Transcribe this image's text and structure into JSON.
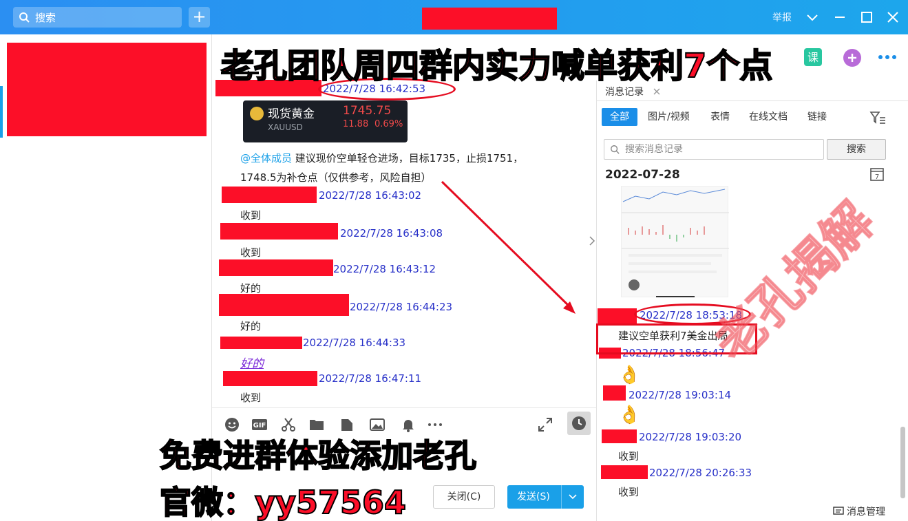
{
  "titlebar": {
    "search_placeholder": "搜索",
    "add_label": "+",
    "report": "举报"
  },
  "overlay": {
    "top_banner": "老孔团队周四群内实力喊单获利7个点",
    "line1": "免费进群体验添加老孔",
    "line2": "官微：yy57564",
    "watermark": "老孔揭解"
  },
  "gold_card": {
    "name": "现货黄金",
    "code": "XAUUSD",
    "price": "1745.75",
    "change": "11.88",
    "percent": "0.69%"
  },
  "chat": {
    "messages": [
      {
        "time": "2022/7/28 16:42:53",
        "text": ""
      },
      {
        "time": "2022/7/28 16:43:02",
        "text": "收到"
      },
      {
        "time": "2022/7/28 16:43:08",
        "text": "收到"
      },
      {
        "time": "2022/7/28 16:43:12",
        "text": "好的"
      },
      {
        "time": "2022/7/28 16:44:23",
        "text": "好的"
      },
      {
        "time": "2022/7/28 16:44:33",
        "text": "好的"
      },
      {
        "time": "2022/7/28 16:47:11",
        "text": "收到"
      }
    ],
    "mention": "@全体成员",
    "advice_line1": "建议现价空单轻仓进场，目标1735，止损1751，",
    "advice_line2": "1748.5为补仓点（仅供参考，风险自担）",
    "close_button": "关闭(C)",
    "send_button": "发送(S)"
  },
  "history": {
    "tab_title": "消息记录",
    "filters": [
      "全部",
      "图片/视频",
      "表情",
      "在线文档",
      "链接"
    ],
    "search_placeholder": "搜索消息记录",
    "search_button": "搜索",
    "date": "2022-07-28",
    "entries": [
      {
        "time": "2022/7/28 18:53:18",
        "text": "建议空单获利7美金出局"
      },
      {
        "time": "2022/7/28 18:56:47",
        "text": ""
      },
      {
        "time": "2022/7/28 19:03:14",
        "text": ""
      },
      {
        "time": "2022/7/28 19:03:20",
        "text": "收到"
      },
      {
        "time": "2022/7/28 20:26:33",
        "text": "收到"
      }
    ],
    "manage": "消息管理"
  }
}
